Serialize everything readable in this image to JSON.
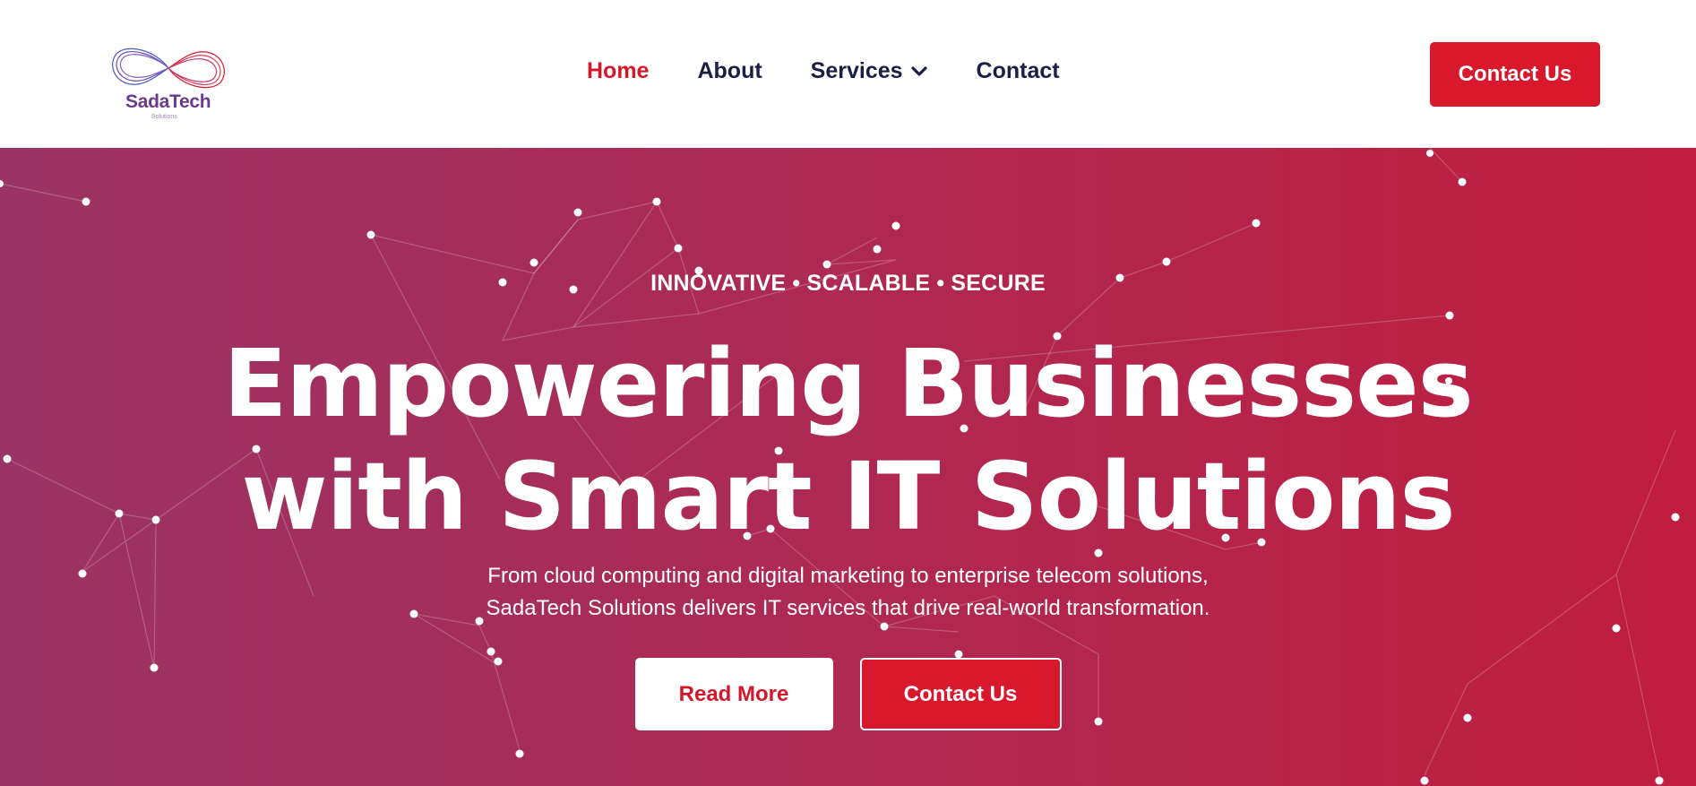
{
  "brand": {
    "name": "SadaTech",
    "sub": "Solutions",
    "primary_color": "#d8182c",
    "nav_text_color": "#1b1f45"
  },
  "nav": {
    "items": [
      {
        "label": "Home",
        "active": true
      },
      {
        "label": "About",
        "active": false
      },
      {
        "label": "Services",
        "active": false,
        "icon": "chevron-down-icon"
      },
      {
        "label": "Contact",
        "active": false
      }
    ],
    "cta_label": "Contact Us"
  },
  "hero": {
    "tagline": "INNOVATIVE • SCALABLE • SECURE",
    "headline_line1": "Empowering Businesses",
    "headline_line2": "with Smart IT Solutions",
    "subtext_line1": "From cloud computing and digital marketing to enterprise telecom solutions,",
    "subtext_line2": "SadaTech Solutions delivers IT services that drive real-world transformation.",
    "read_more_label": "Read More",
    "contact_label": "Contact Us",
    "gradient_start": "#9a3464",
    "gradient_end": "#c01e3e"
  }
}
